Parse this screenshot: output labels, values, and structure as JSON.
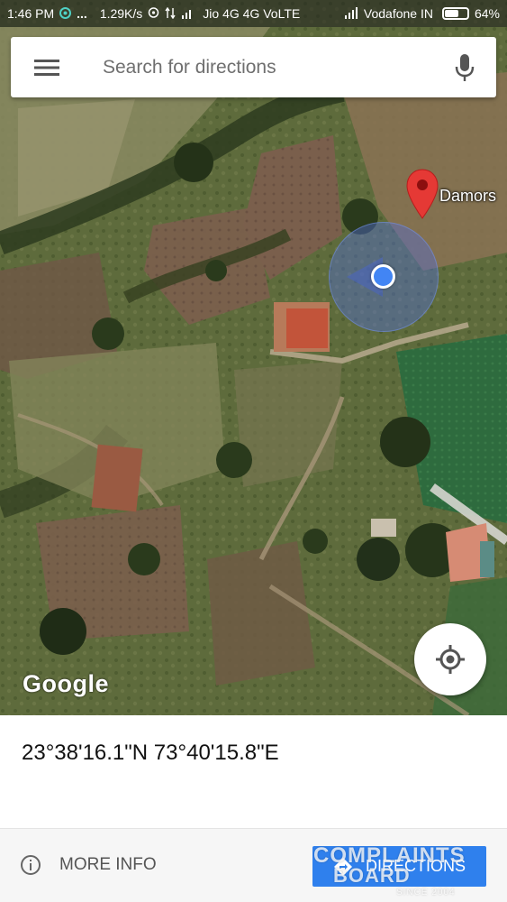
{
  "status_bar": {
    "time": "1:46 PM",
    "app_icon": "circle-app-icon",
    "more": "...",
    "speed": "1.29K/s",
    "sim1": "Jio 4G 4G VoLTE",
    "sim2": "Vodafone IN",
    "battery": "64%",
    "battery_level": 0.64
  },
  "search": {
    "placeholder": "Search for directions",
    "menu_icon": "hamburger-menu-icon",
    "mic_icon": "microphone-icon"
  },
  "map": {
    "type": "satellite",
    "pin_label": "Damors",
    "pin_color": "#e53935",
    "location_dot_color": "#4285f4",
    "logo": "Google"
  },
  "place": {
    "coordinates": "23°38'16.1\"N 73°40'15.8\"E"
  },
  "actions": {
    "more_info_label": "MORE INFO",
    "directions_label": "DIRECTIONS",
    "directions_color": "#2f80ed"
  },
  "watermark": {
    "line1": "COMPLAINTS",
    "line2": "BOARD",
    "line3": "SINCE 2004"
  }
}
